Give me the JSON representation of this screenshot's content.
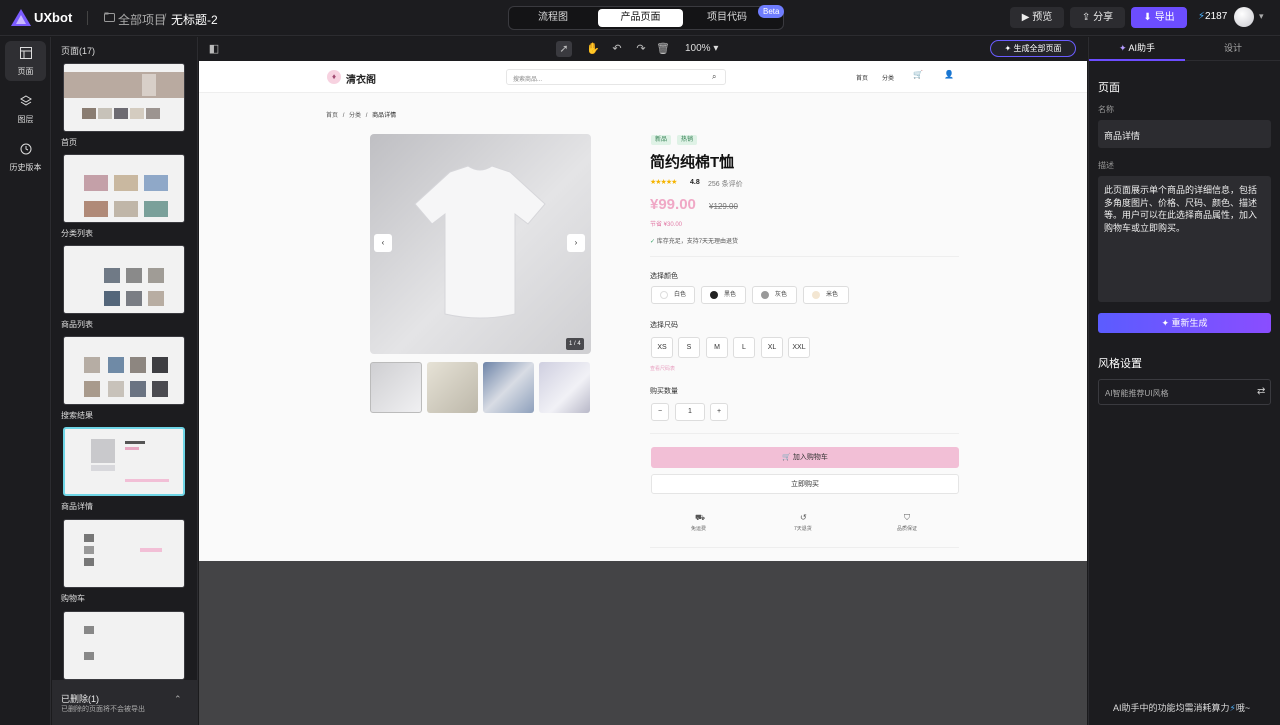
{
  "app": {
    "logo_text": "UXbot",
    "breadcrumb_root": "全部项目",
    "breadcrumb_sep": "/",
    "project_title": "无标题-2"
  },
  "mode_tabs": [
    {
      "label": "流程图"
    },
    {
      "label": "产品页面"
    },
    {
      "label": "项目代码"
    }
  ],
  "beta_badge": "Beta",
  "actions": {
    "preview": "预览",
    "share": "分享",
    "export": "导出"
  },
  "credits": "2187",
  "rail": [
    {
      "label": "页面"
    },
    {
      "label": "图层"
    },
    {
      "label": "历史版本"
    }
  ],
  "pages": {
    "title": "页面(17)",
    "items": [
      {
        "label": "首页"
      },
      {
        "label": "分类列表"
      },
      {
        "label": "商品列表"
      },
      {
        "label": "搜索结果"
      },
      {
        "label": "商品详情"
      },
      {
        "label": "购物车"
      }
    ],
    "deleted_title": "已删除(1)",
    "deleted_note": "已删除的页面将不会被导出"
  },
  "canvas_toolbar": {
    "zoom": "100%",
    "generate_all": "生成全部页面"
  },
  "site": {
    "brand": "清衣阁",
    "search_placeholder": "搜索商品...",
    "nav": [
      "首页",
      "分类"
    ],
    "breadcrumb": [
      "首页",
      "/",
      "分类",
      "/",
      "商品详情"
    ],
    "image_counter": "1 / 4",
    "tags": [
      "新品",
      "热销"
    ],
    "product_name": "简约纯棉T恤",
    "rating": "4.8",
    "reviews": "256 条评价",
    "price": "¥99.00",
    "old_price": "¥129.00",
    "savings": "节省 ¥30.00",
    "stock_note": "库存充足，支持7天无理由退货",
    "color_label": "选择颜色",
    "colors": [
      {
        "name": "白色",
        "hex": "#ffffff"
      },
      {
        "name": "黑色",
        "hex": "#222222"
      },
      {
        "name": "灰色",
        "hex": "#999999"
      },
      {
        "name": "米色",
        "hex": "#f3e6d2"
      }
    ],
    "size_label": "选择尺码",
    "sizes": [
      "XS",
      "S",
      "M",
      "L",
      "XL",
      "XXL"
    ],
    "size_guide": "查看尺码表",
    "qty_label": "购买数量",
    "qty_minus": "−",
    "qty_value": "1",
    "qty_plus": "+",
    "add_to_cart": "加入购物车",
    "buy_now": "立即购买",
    "services": [
      "免运费",
      "7天退货",
      "品质保证"
    ],
    "accent": "#f2bfd6"
  },
  "right_panel": {
    "tabs": [
      "AI助手",
      "设计"
    ],
    "section_title": "页面",
    "name_label": "名称",
    "name_value": "商品详情",
    "desc_label": "描述",
    "desc_value": "此页面展示单个商品的详细信息，包括多角度图片、价格、尺码、颜色、描述等。用户可以在此选择商品属性，加入购物车或立即购买。",
    "regenerate": "重新生成",
    "style_title": "风格设置",
    "style_placeholder": "AI智能推荐UI风格",
    "footer_note": "AI助手中的功能均需消耗算力",
    "footer_tail": "哦~"
  }
}
